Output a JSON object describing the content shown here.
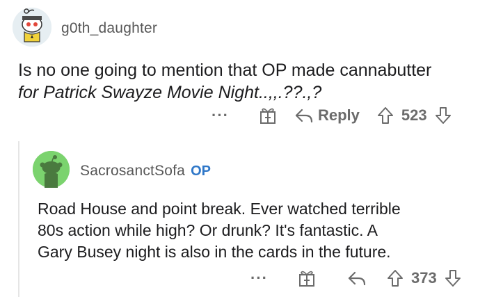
{
  "comment": {
    "username": "g0th_daughter",
    "text_plain": "Is no one going to mention that OP made cannabutter",
    "text_italic": "for Patrick Swayze Movie Night..,,.??.,?",
    "actions": {
      "more": "···",
      "reply_label": "Reply",
      "score": "523"
    }
  },
  "reply": {
    "username": "SacrosanctSofa",
    "op_badge": "OP",
    "text_lines": [
      "Road House and point break. Ever watched terrible",
      "80s action while high? Or drunk? It's fantastic. A",
      "Gary Busey night is also in the cards in the future."
    ],
    "actions": {
      "more": "···",
      "score": "373"
    }
  },
  "colors": {
    "op_badge": "#2f77c8",
    "op_avatar": "#7bd36e",
    "action_gray": "#6b6b6b"
  },
  "icons": [
    "snoo-avatar-icon",
    "gift-icon",
    "reply-arrow-icon",
    "upvote-icon",
    "downvote-icon"
  ]
}
